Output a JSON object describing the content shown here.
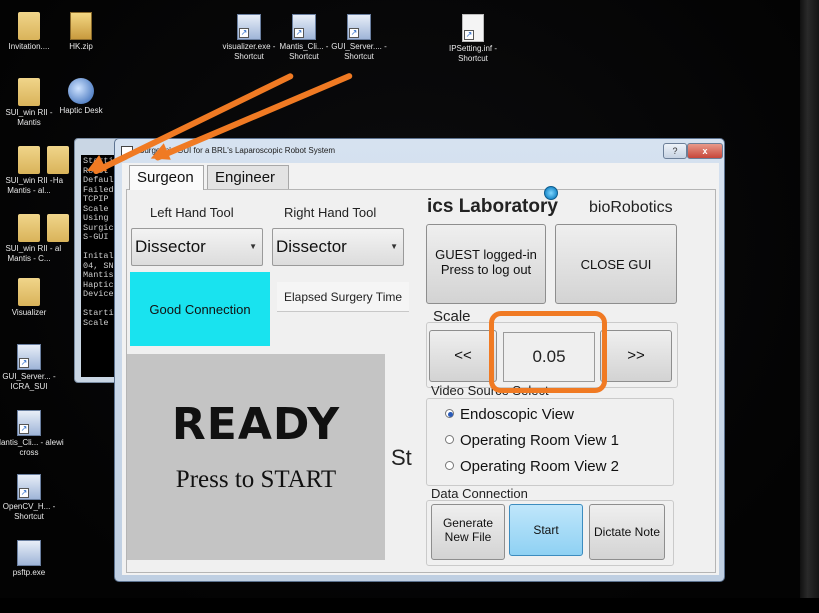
{
  "desktop": {
    "icons": [
      {
        "label": "Invitation....",
        "icon": "folder-icon"
      },
      {
        "label": "HK.zip",
        "icon": "zip-icon"
      },
      {
        "label": "visualizer.exe - Shortcut",
        "icon": "shortcut-icon"
      },
      {
        "label": "Mantis_Cli... - Shortcut",
        "icon": "shortcut-icon"
      },
      {
        "label": "GUI_Server.... - Shortcut",
        "icon": "shortcut-icon"
      },
      {
        "label": "IPSetting.inf - Shortcut",
        "icon": "file-shortcut-icon"
      },
      {
        "label": "SUI_win RII - Mantis",
        "icon": "folder-icon"
      },
      {
        "label": "Haptic Desk",
        "icon": "haptic-icon"
      },
      {
        "label": "SUI_win RII - Mantis - al...",
        "icon": "folder-icon"
      },
      {
        "label": "Ha",
        "icon": "folder-icon"
      },
      {
        "label": "SUI_win RII - Mantis - C...",
        "icon": "folder-icon"
      },
      {
        "label": "al",
        "icon": "folder-icon"
      },
      {
        "label": "Visualizer",
        "icon": "folder-icon"
      },
      {
        "label": "GUI_Server... - ICRA_SUI",
        "icon": "shortcut-icon"
      },
      {
        "label": "Mantis_Cli... - alewi cross",
        "icon": "shortcut-icon"
      },
      {
        "label": "OpenCV_H... - Shortcut",
        "icon": "shortcut-icon"
      },
      {
        "label": "psftp.exe",
        "icon": "exe-icon"
      }
    ]
  },
  "console": {
    "lines": "Startin\nRobot\nDefaul\nFailed\nTCPIP\nScale\nUsing\nSurgic\nS-GUI\n\nInital\n04, SN\nMantis\nHaptic\nDevice\n\nStarti\nScale"
  },
  "window": {
    "title": "Surgeon's GUI for a BRL's Laparoscopic Robot System",
    "help_label": "?",
    "close_label": "x"
  },
  "tabs": [
    {
      "label": "Surgeon",
      "active": true
    },
    {
      "label": "Engineer",
      "active": false
    }
  ],
  "surgeon": {
    "left_tool_label": "Left Hand Tool",
    "right_tool_label": "Right Hand Tool",
    "left_tool_value": "Dissector",
    "right_tool_value": "Dissector",
    "connection_status": "Good Connection",
    "elapsed_label": "Elapsed Surgery Time",
    "ready_title": "READY",
    "ready_subtitle": "Press to START",
    "partial_text": "St",
    "lab_banner": "ics Laboratory",
    "lab_banner_2": "bioRobotics",
    "guest_button": "GUEST logged-in\nPress to log out",
    "close_gui_button": "CLOSE GUI",
    "scale_label": "Scale",
    "scale_down": "<<",
    "scale_value": "0.05",
    "scale_up": ">>",
    "video_source_label": "Video Source Select",
    "video_options": [
      {
        "label": "Endoscopic View",
        "selected": true
      },
      {
        "label": "Operating Room View 1",
        "selected": false
      },
      {
        "label": "Operating Room View 2",
        "selected": false
      }
    ],
    "data_connection_label": "Data Connection",
    "generate_button": "Generate\nNew File",
    "start_button": "Start",
    "dictate_button": "Dictate Note"
  },
  "colors": {
    "connection_good": "#19e3ef",
    "annotation": "#f07a23",
    "start_active": "#8fd1f3"
  }
}
